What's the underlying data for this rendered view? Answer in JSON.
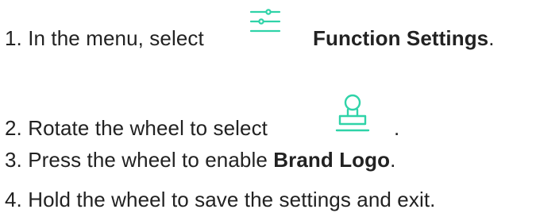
{
  "steps": [
    {
      "number": "1.",
      "text_before": "In the menu, select",
      "icon": "function-settings-sliders-icon",
      "bold_text": "Function Settings",
      "text_after": "."
    },
    {
      "number": "2.",
      "text_before": "Rotate the wheel to select",
      "icon": "brand-logo-stamp-icon",
      "text_after": "."
    },
    {
      "number": "3.",
      "text_before": "Press the wheel to enable",
      "bold_text": "Brand Logo",
      "text_after": "."
    },
    {
      "number": "4.",
      "text_before": "Hold the wheel to save the settings and exit."
    }
  ],
  "colors": {
    "text": "#222222",
    "icon_accent": "#2fd3a8"
  }
}
